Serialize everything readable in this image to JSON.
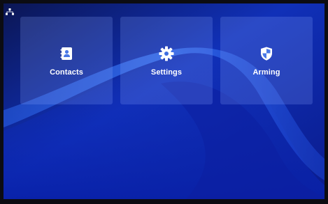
{
  "status_bar": {
    "icon": "network-icon"
  },
  "tiles": [
    {
      "label": "Contacts",
      "icon": "contacts-icon"
    },
    {
      "label": "Settings",
      "icon": "gear-icon"
    },
    {
      "label": "Arming",
      "icon": "shield-icon"
    }
  ],
  "colors": {
    "background_dark": "#0a0f3a",
    "background_light": "#1b3fd6",
    "tile_fill": "rgba(140,170,255,0.22)",
    "text": "#ffffff"
  }
}
